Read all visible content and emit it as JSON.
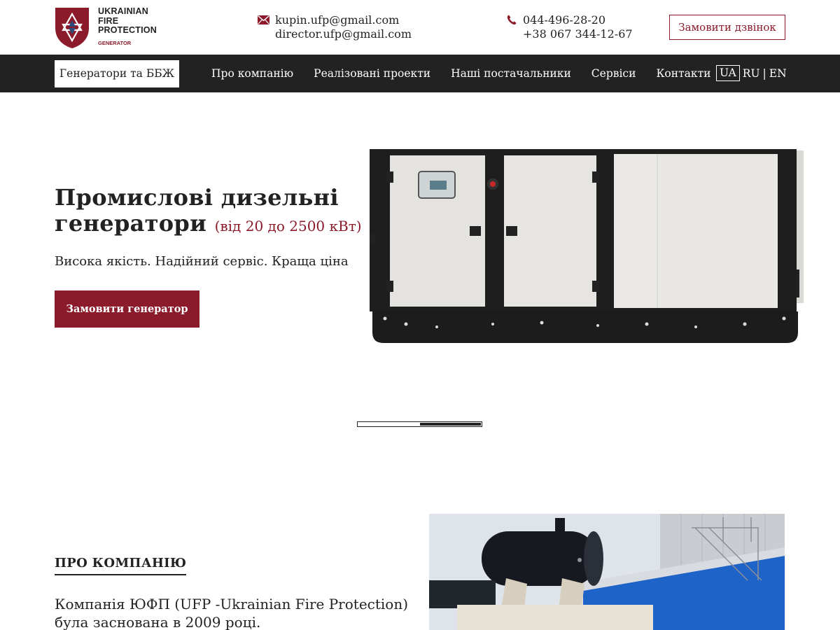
{
  "header": {
    "logo": {
      "line1": "UKRAINIAN",
      "line2": "FIRE",
      "line3": "PROTECTION",
      "sub": "GENERATOR"
    },
    "emails": [
      "kupin.ufp@gmail.com",
      "director.ufp@gmail.com"
    ],
    "phones": [
      "044-496-28-20",
      "+38 067 344-12-67"
    ],
    "call_button": "Замовити дзвінок",
    "email_icon": "envelope-icon",
    "phone_icon": "phone-icon"
  },
  "nav": {
    "active": "Генератори та ББЖ",
    "items": [
      "Про компанію",
      "Реалізовані проекти",
      "Наші постачальники",
      "Сервіси",
      "Контакти"
    ],
    "languages": [
      "UA",
      "RU",
      "EN"
    ],
    "selected_language": "UA"
  },
  "hero": {
    "title_line1": "Промислові дизельні",
    "title_line2": "генератори",
    "range": "(від 20 до 2500 кВт)",
    "subtitle": "Висока якість. Надійний сервіс. Краща ціна",
    "button": "Замовити генератор",
    "slider_position": 0.5
  },
  "about": {
    "title": "ПРО КОМПАНІЮ",
    "text_line1": "Компанія ЮФП (UFP -Ukrainian Fire Protection)",
    "text_line2": "була заснована в 2009 році."
  },
  "colors": {
    "brand": "#8b1a2b",
    "nav_bg": "#222222",
    "text": "#222222"
  }
}
